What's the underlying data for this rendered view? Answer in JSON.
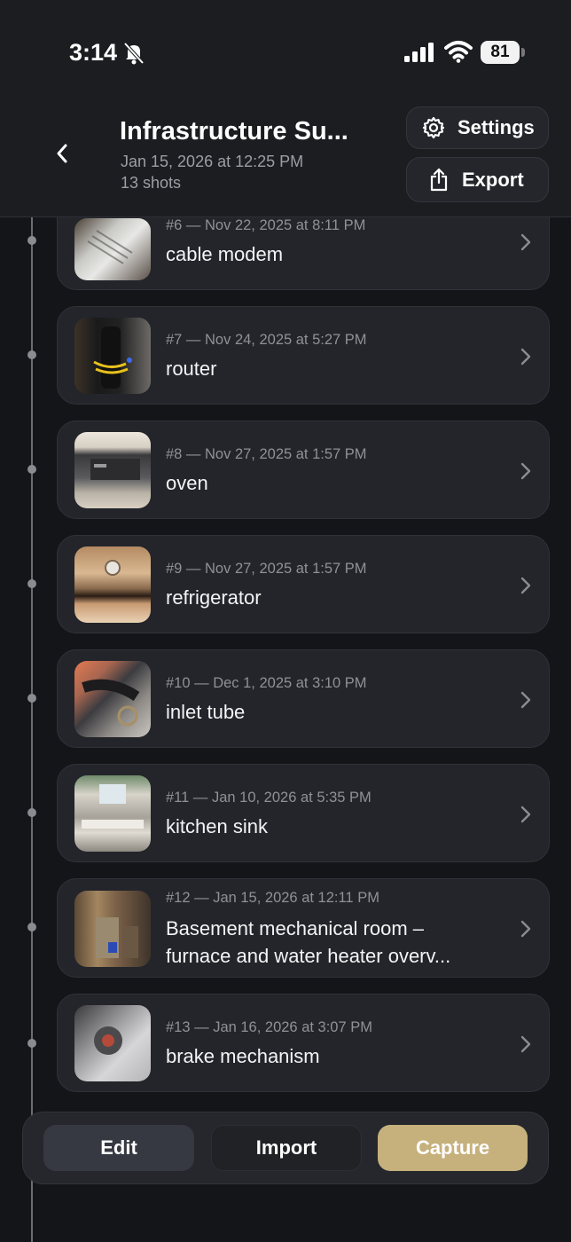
{
  "status_bar": {
    "time": "3:14",
    "battery": "81"
  },
  "header": {
    "title": "Infrastructure Su...",
    "date": "Jan 15, 2026 at 12:25 PM",
    "shot_count": "13 shots",
    "settings_label": "Settings",
    "export_label": "Export"
  },
  "shots": [
    {
      "meta": "#6  —  Nov 22, 2025 at 8:11 PM",
      "title": "cable modem"
    },
    {
      "meta": "#7  —  Nov 24, 2025 at 5:27 PM",
      "title": "router"
    },
    {
      "meta": "#8  —  Nov 27, 2025 at 1:57 PM",
      "title": "oven"
    },
    {
      "meta": "#9  —  Nov 27, 2025 at 1:57 PM",
      "title": "refrigerator"
    },
    {
      "meta": "#10  —  Dec 1, 2025 at 3:10 PM",
      "title": "inlet tube"
    },
    {
      "meta": "#11  —  Jan 10, 2026 at 5:35 PM",
      "title": "kitchen sink"
    },
    {
      "meta": "#12  —  Jan 15, 2026 at 12:11 PM",
      "title_line1": "Basement mechanical room –",
      "title_line2": "furnace and water heater overv..."
    },
    {
      "meta": "#13  —  Jan 16, 2026 at 3:07 PM",
      "title": "brake mechanism"
    }
  ],
  "bottom_bar": {
    "edit_label": "Edit",
    "import_label": "Import",
    "capture_label": "Capture"
  },
  "colors": {
    "background": "#141518",
    "card": "#23252a",
    "accent": "#c6b07c"
  }
}
